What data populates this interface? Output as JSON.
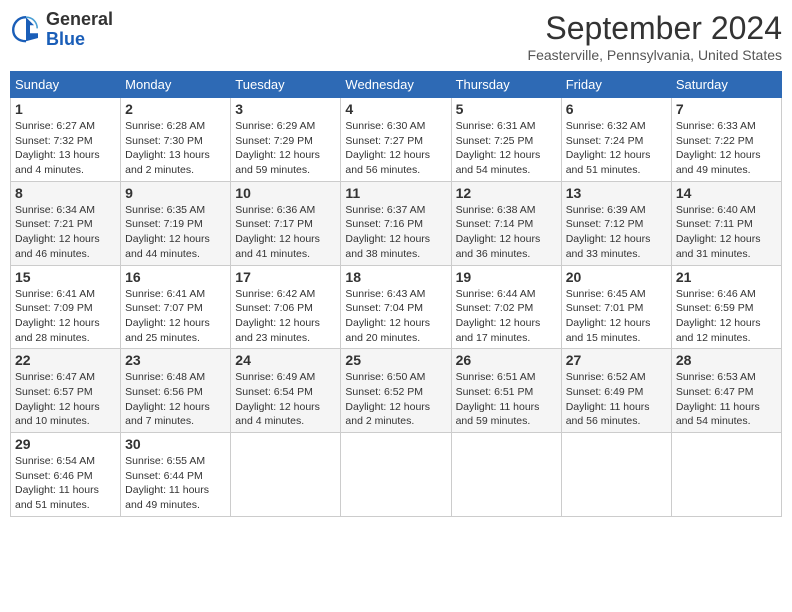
{
  "header": {
    "logo": {
      "general": "General",
      "blue": "Blue"
    },
    "title": "September 2024",
    "location": "Feasterville, Pennsylvania, United States"
  },
  "days_of_week": [
    "Sunday",
    "Monday",
    "Tuesday",
    "Wednesday",
    "Thursday",
    "Friday",
    "Saturday"
  ],
  "weeks": [
    [
      {
        "day": "1",
        "sunrise": "6:27 AM",
        "sunset": "7:32 PM",
        "daylight": "13 hours and 4 minutes."
      },
      {
        "day": "2",
        "sunrise": "6:28 AM",
        "sunset": "7:30 PM",
        "daylight": "13 hours and 2 minutes."
      },
      {
        "day": "3",
        "sunrise": "6:29 AM",
        "sunset": "7:29 PM",
        "daylight": "12 hours and 59 minutes."
      },
      {
        "day": "4",
        "sunrise": "6:30 AM",
        "sunset": "7:27 PM",
        "daylight": "12 hours and 56 minutes."
      },
      {
        "day": "5",
        "sunrise": "6:31 AM",
        "sunset": "7:25 PM",
        "daylight": "12 hours and 54 minutes."
      },
      {
        "day": "6",
        "sunrise": "6:32 AM",
        "sunset": "7:24 PM",
        "daylight": "12 hours and 51 minutes."
      },
      {
        "day": "7",
        "sunrise": "6:33 AM",
        "sunset": "7:22 PM",
        "daylight": "12 hours and 49 minutes."
      }
    ],
    [
      {
        "day": "8",
        "sunrise": "6:34 AM",
        "sunset": "7:21 PM",
        "daylight": "12 hours and 46 minutes."
      },
      {
        "day": "9",
        "sunrise": "6:35 AM",
        "sunset": "7:19 PM",
        "daylight": "12 hours and 44 minutes."
      },
      {
        "day": "10",
        "sunrise": "6:36 AM",
        "sunset": "7:17 PM",
        "daylight": "12 hours and 41 minutes."
      },
      {
        "day": "11",
        "sunrise": "6:37 AM",
        "sunset": "7:16 PM",
        "daylight": "12 hours and 38 minutes."
      },
      {
        "day": "12",
        "sunrise": "6:38 AM",
        "sunset": "7:14 PM",
        "daylight": "12 hours and 36 minutes."
      },
      {
        "day": "13",
        "sunrise": "6:39 AM",
        "sunset": "7:12 PM",
        "daylight": "12 hours and 33 minutes."
      },
      {
        "day": "14",
        "sunrise": "6:40 AM",
        "sunset": "7:11 PM",
        "daylight": "12 hours and 31 minutes."
      }
    ],
    [
      {
        "day": "15",
        "sunrise": "6:41 AM",
        "sunset": "7:09 PM",
        "daylight": "12 hours and 28 minutes."
      },
      {
        "day": "16",
        "sunrise": "6:41 AM",
        "sunset": "7:07 PM",
        "daylight": "12 hours and 25 minutes."
      },
      {
        "day": "17",
        "sunrise": "6:42 AM",
        "sunset": "7:06 PM",
        "daylight": "12 hours and 23 minutes."
      },
      {
        "day": "18",
        "sunrise": "6:43 AM",
        "sunset": "7:04 PM",
        "daylight": "12 hours and 20 minutes."
      },
      {
        "day": "19",
        "sunrise": "6:44 AM",
        "sunset": "7:02 PM",
        "daylight": "12 hours and 17 minutes."
      },
      {
        "day": "20",
        "sunrise": "6:45 AM",
        "sunset": "7:01 PM",
        "daylight": "12 hours and 15 minutes."
      },
      {
        "day": "21",
        "sunrise": "6:46 AM",
        "sunset": "6:59 PM",
        "daylight": "12 hours and 12 minutes."
      }
    ],
    [
      {
        "day": "22",
        "sunrise": "6:47 AM",
        "sunset": "6:57 PM",
        "daylight": "12 hours and 10 minutes."
      },
      {
        "day": "23",
        "sunrise": "6:48 AM",
        "sunset": "6:56 PM",
        "daylight": "12 hours and 7 minutes."
      },
      {
        "day": "24",
        "sunrise": "6:49 AM",
        "sunset": "6:54 PM",
        "daylight": "12 hours and 4 minutes."
      },
      {
        "day": "25",
        "sunrise": "6:50 AM",
        "sunset": "6:52 PM",
        "daylight": "12 hours and 2 minutes."
      },
      {
        "day": "26",
        "sunrise": "6:51 AM",
        "sunset": "6:51 PM",
        "daylight": "11 hours and 59 minutes."
      },
      {
        "day": "27",
        "sunrise": "6:52 AM",
        "sunset": "6:49 PM",
        "daylight": "11 hours and 56 minutes."
      },
      {
        "day": "28",
        "sunrise": "6:53 AM",
        "sunset": "6:47 PM",
        "daylight": "11 hours and 54 minutes."
      }
    ],
    [
      {
        "day": "29",
        "sunrise": "6:54 AM",
        "sunset": "6:46 PM",
        "daylight": "11 hours and 51 minutes."
      },
      {
        "day": "30",
        "sunrise": "6:55 AM",
        "sunset": "6:44 PM",
        "daylight": "11 hours and 49 minutes."
      },
      null,
      null,
      null,
      null,
      null
    ]
  ]
}
